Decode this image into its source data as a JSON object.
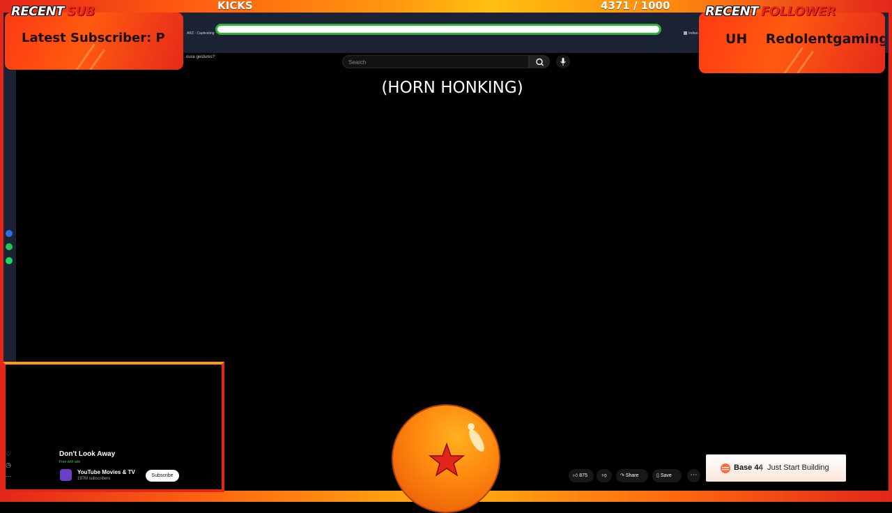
{
  "overlay": {
    "goal_label": "KICKS",
    "goal_count": "4371 / 1000",
    "recent_sub_header": [
      "RECENT",
      "SUB"
    ],
    "recent_sub_text": "Latest Subscriber: P",
    "recent_follower_header": [
      "RECENT",
      "FOLLOWER"
    ],
    "recent_follower_text": "UH    Redolentgaming"
  },
  "browser": {
    "bookmark_left": "ARZ - Captivating",
    "bookmark_right": "Indian",
    "gesture_text": "ouse gestures?",
    "accent_color": "#2fb33a"
  },
  "youtube": {
    "search_placeholder": "Search",
    "caption": "(HORN HONKING)",
    "video_title": "Don't Look Away",
    "free_label": "Free with ads",
    "channel_name": "YouTube Movies & TV",
    "channel_subscribers": "197M subscribers",
    "subscribe_label": "Subscribe",
    "like_count": "875",
    "share_label": "Share",
    "save_label": "Save"
  },
  "ad": {
    "brand": "Base 44",
    "separator": "|",
    "tagline": "Just Start Building"
  },
  "icons": {
    "search": "search-icon",
    "mic": "mic-icon",
    "like": "thumbs-up-icon",
    "dislike": "thumbs-down-icon",
    "share": "share-icon",
    "save": "bookmark-icon",
    "more": "more-icon"
  },
  "colors": {
    "frame_red": "#e3261a",
    "frame_orange": "#ff9a10",
    "panel_orange": "#ff5a10",
    "dragon_ball": "#ff8a10",
    "star": "#e3261a"
  }
}
